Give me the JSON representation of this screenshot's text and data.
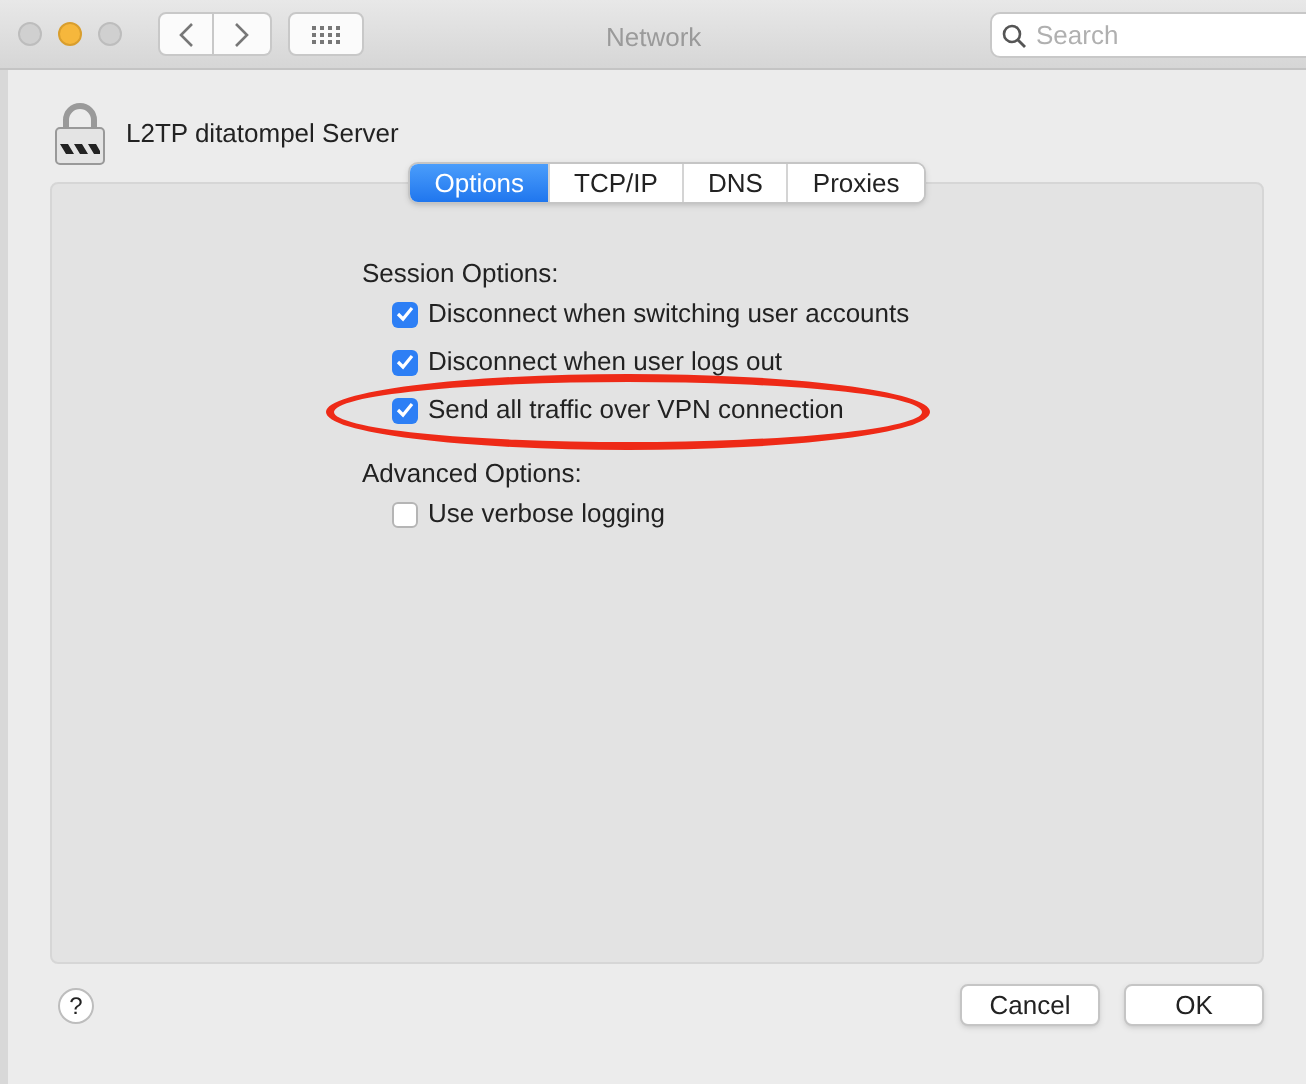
{
  "window": {
    "title": "Network"
  },
  "search": {
    "placeholder": "Search"
  },
  "connection": {
    "name": "L2TP ditatompel Server"
  },
  "tabs": [
    {
      "label": "Options",
      "selected": true
    },
    {
      "label": "TCP/IP",
      "selected": false
    },
    {
      "label": "DNS",
      "selected": false
    },
    {
      "label": "Proxies",
      "selected": false
    }
  ],
  "sections": [
    {
      "heading": "Session Options:",
      "options": [
        {
          "label": "Disconnect when switching user accounts",
          "checked": true,
          "highlighted": false
        },
        {
          "label": "Disconnect when user logs out",
          "checked": true,
          "highlighted": false
        },
        {
          "label": "Send all traffic over VPN connection",
          "checked": true,
          "highlighted": true
        }
      ]
    },
    {
      "heading": "Advanced Options:",
      "options": [
        {
          "label": "Use verbose logging",
          "checked": false,
          "highlighted": false
        }
      ]
    }
  ],
  "help": {
    "label": "?"
  },
  "buttons": [
    "Cancel",
    "OK"
  ]
}
